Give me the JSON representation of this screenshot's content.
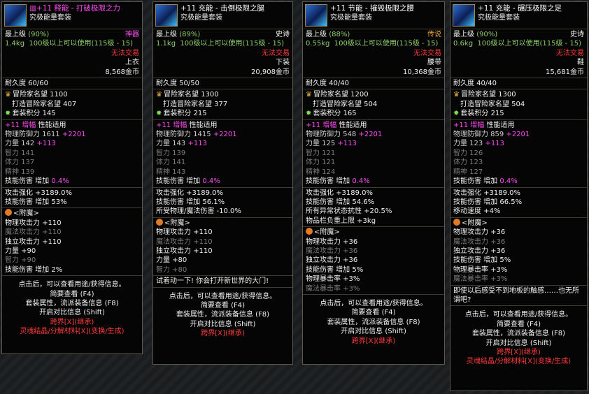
{
  "tooltips": [
    {
      "title1": "+11 释能 - 打破极限之力",
      "title2": "究极能量套装",
      "title1_color": "#ff4cf2",
      "title_prefix": "▥",
      "grade": "最上级",
      "grade_pct": "(90%)",
      "rarity": "神器",
      "rarity_color": "#ff4cf2",
      "weight": "1.4kg",
      "req": "100级以上可以使用(115级 - 15)",
      "trade": "无法交易",
      "slot": "上衣",
      "price": "8,568金币",
      "dur": "耐久度 60/60",
      "fame": "冒险家名望 1100",
      "fame2": "打造冒险家名望 407",
      "setpt": "套装积分 145",
      "amp_label": "+11 增幅",
      "amp_tail": "性能适用",
      "stats": [
        {
          "t": "物理防御力 1611",
          "b": "+2201",
          "c": "def"
        },
        {
          "t": "力量 142",
          "b": "+113",
          "c": "def"
        },
        {
          "t": "智力 141",
          "c": "gry"
        },
        {
          "t": "体力 137",
          "c": "gry"
        },
        {
          "t": "精神 139",
          "c": "gry"
        }
      ],
      "skill": "技能伤害 增加",
      "skill_v": "0.4%",
      "extra": [
        {
          "t": "攻击强化 +3189.0%"
        },
        {
          "t": "技能伤害 增加 53%"
        }
      ],
      "enchant": "<附魔>",
      "enchant_lines": [
        {
          "t": "物理攻击力 +110",
          "c": "wht"
        },
        {
          "t": "魔法攻击力 +110",
          "c": "gry"
        },
        {
          "t": "独立攻击力 +110",
          "c": "wht"
        },
        {
          "t": "力量 +90",
          "c": "wht"
        },
        {
          "t": "智力 +90",
          "c": "gry"
        },
        {
          "t": "技能伤害 增加 2%",
          "c": "wht"
        }
      ],
      "flavor": "",
      "foot": [
        "点击后，可以查看用途/获得信息。",
        "简要查看 (F4)",
        "套装属性，流派装备信息 (F8)",
        "开启对比信息 (Shift)"
      ],
      "foot_red": [
        "跨界[X](继承)",
        "灵魂结晶/分解材料[X](变换/生成)"
      ]
    },
    {
      "title1": "+11 充能 - 击倒极限之腿",
      "title2": "究极能量套装",
      "title1_color": "#ffffff",
      "title_prefix": "",
      "grade": "最上级",
      "grade_pct": "(89%)",
      "rarity": "史诗",
      "rarity_color": "#ffffff",
      "weight": "1.1kg",
      "req": "100级以上可以使用(115级 - 15)",
      "trade": "无法交易",
      "slot": "下装",
      "price": "20,908金币",
      "dur": "耐久度 50/50",
      "fame": "冒险家名望 1300",
      "fame2": "打造冒险家名望 377",
      "setpt": "套装积分 215",
      "amp_label": "+11 增幅",
      "amp_tail": "性能适用",
      "stats": [
        {
          "t": "物理防御力 1415",
          "b": "+2201",
          "c": "def"
        },
        {
          "t": "力量 143",
          "b": "+113",
          "c": "def"
        },
        {
          "t": "智力 139",
          "c": "gry"
        },
        {
          "t": "体力 141",
          "c": "gry"
        },
        {
          "t": "精神 143",
          "c": "gry"
        }
      ],
      "skill": "技能伤害 增加",
      "skill_v": "0.4%",
      "extra": [
        {
          "t": "攻击强化 +3189.0%"
        },
        {
          "t": "技能伤害 增加 56.1%"
        },
        {
          "t": "所受物理/魔法伤害 -10.0%"
        }
      ],
      "enchant": "<附魔>",
      "enchant_lines": [
        {
          "t": "物理攻击力 +110",
          "c": "wht"
        },
        {
          "t": "魔法攻击力 +110",
          "c": "gry"
        },
        {
          "t": "独立攻击力 +110",
          "c": "wht"
        },
        {
          "t": "力量 +80",
          "c": "wht"
        },
        {
          "t": "智力 +80",
          "c": "gry"
        }
      ],
      "flavor": "试着动一下! 你会打开新世界的大门!",
      "foot": [
        "点击后，可以查看用途/获得信息。",
        "简要查看 (F4)",
        "套装属性，流派装备信息 (F8)",
        "开启对比信息 (Shift)"
      ],
      "foot_red": [
        "跨界[X](继承)"
      ]
    },
    {
      "title1": "+11 节能 - 摧毁极限之腰",
      "title2": "究极能量套装",
      "title1_color": "#ffffff",
      "title_prefix": "",
      "grade": "最上级",
      "grade_pct": "(88%)",
      "rarity": "传说",
      "rarity_color": "#e8a23c",
      "weight": "0.55kg",
      "req": "100级以上可以使用(115级 - 15)",
      "trade": "无法交易",
      "slot": "腰带",
      "price": "10,368金币",
      "dur": "耐久度 40/40",
      "fame": "冒险家名望 1200",
      "fame2": "打造冒险家名望 504",
      "setpt": "套装积分 165",
      "amp_label": "+11 增幅",
      "amp_tail": "性能适用",
      "stats": [
        {
          "t": "物理防御力 548",
          "b": "+2201",
          "c": "def"
        },
        {
          "t": "力量 125",
          "b": "+113",
          "c": "def"
        },
        {
          "t": "智力 121",
          "c": "gry"
        },
        {
          "t": "体力 121",
          "c": "gry"
        },
        {
          "t": "精神 124",
          "c": "gry"
        }
      ],
      "skill": "技能伤害 增加",
      "skill_v": "0.4%",
      "extra": [
        {
          "t": "攻击强化 +3189.0%"
        },
        {
          "t": "技能伤害 增加 54.6%"
        },
        {
          "t": "所有异常状态抗性 +20.5%"
        },
        {
          "t": "物品栏负重上限 +3kg"
        }
      ],
      "enchant": "<附魔>",
      "enchant_lines": [
        {
          "t": "物理攻击力 +36",
          "c": "wht"
        },
        {
          "t": "魔法攻击力 +36",
          "c": "gry"
        },
        {
          "t": "独立攻击力 +36",
          "c": "wht"
        },
        {
          "t": "技能伤害 增加 5%",
          "c": "wht"
        },
        {
          "t": "物理暴击率 +3%",
          "c": "wht"
        },
        {
          "t": "魔法暴击率 +3%",
          "c": "gry"
        }
      ],
      "flavor": "",
      "foot": [
        "点击后，可以查看用途/获得信息。",
        "简要查看 (F4)",
        "套装属性，流派装备信息 (F8)",
        "开启对比信息 (Shift)"
      ],
      "foot_red": [
        "跨界[X](继承)"
      ]
    },
    {
      "title1": "+11 充能 - 碾压极限之足",
      "title2": "究极能量套装",
      "title1_color": "#ffffff",
      "title_prefix": "",
      "grade": "最上级",
      "grade_pct": "(90%)",
      "rarity": "史诗",
      "rarity_color": "#ffffff",
      "weight": "0.6kg",
      "req": "100级以上可以使用(115级 - 15)",
      "trade": "无法交易",
      "slot": "鞋",
      "price": "15,681金币",
      "dur": "耐久度 40/40",
      "fame": "冒险家名望 1300",
      "fame2": "打造冒险家名望 504",
      "setpt": "套装积分 215",
      "amp_label": "+11 增幅",
      "amp_tail": "性能适用",
      "stats": [
        {
          "t": "物理防御力 859",
          "b": "+2201",
          "c": "def"
        },
        {
          "t": "力量 123",
          "b": "+113",
          "c": "def"
        },
        {
          "t": "智力 126",
          "c": "gry"
        },
        {
          "t": "体力 123",
          "c": "gry"
        },
        {
          "t": "精神 127",
          "c": "gry"
        }
      ],
      "skill": "技能伤害 增加",
      "skill_v": "0.4%",
      "extra": [
        {
          "t": "攻击强化 +3189.0%"
        },
        {
          "t": "技能伤害 增加 66.5%"
        },
        {
          "t": "移动速度 +4%"
        }
      ],
      "enchant": "<附魔>",
      "enchant_lines": [
        {
          "t": "物理攻击力 +36",
          "c": "wht"
        },
        {
          "t": "魔法攻击力 +36",
          "c": "gry"
        },
        {
          "t": "独立攻击力 +36",
          "c": "wht"
        },
        {
          "t": "技能伤害 增加 5%",
          "c": "wht"
        },
        {
          "t": "物理暴击率 +3%",
          "c": "wht"
        },
        {
          "t": "魔法暴击率 +3%",
          "c": "gry"
        }
      ],
      "flavor": "即使以后感受不到地板的触感……也无所谓吧?",
      "foot": [
        "点击后，可以查看用途/获得信息。",
        "简要查看 (F4)",
        "套装属性，流派装备信息 (F8)",
        "开启对比信息 (Shift)"
      ],
      "foot_red": [
        "跨界[X](继承)",
        "灵魂结晶/分解材料[X](变换/生成)"
      ]
    }
  ]
}
